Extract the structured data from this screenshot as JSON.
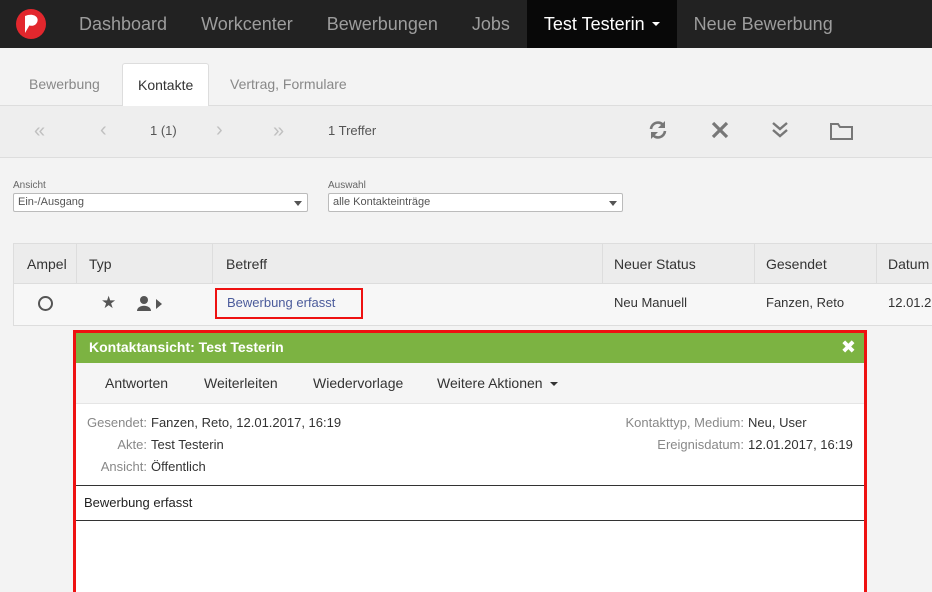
{
  "nav": {
    "logo_icon": "brand-logo-icon",
    "items": [
      {
        "label": "Dashboard"
      },
      {
        "label": "Workcenter"
      },
      {
        "label": "Bewerbungen"
      },
      {
        "label": "Jobs"
      },
      {
        "label": "Test Testerin"
      },
      {
        "label": "Neue Bewerbung"
      }
    ],
    "bg_color": "#222222"
  },
  "tabs": [
    {
      "label": "Bewerbung"
    },
    {
      "label": "Kontakte"
    },
    {
      "label": "Vertrag, Formulare"
    }
  ],
  "pager": {
    "first_icon": "«",
    "prev_icon": "‹",
    "page": "1 (1)",
    "next_icon": "›",
    "last_icon": "»",
    "hits": "1 Treffer"
  },
  "toolbar_icons": [
    "refresh-icon",
    "close-icon",
    "chevron-double-down-icon",
    "folder-icon"
  ],
  "filters": {
    "ansicht_label": "Ansicht",
    "ansicht_value": "Ein-/Ausgang",
    "auswahl_label": "Auswahl",
    "auswahl_value": "alle Kontakteinträge"
  },
  "table": {
    "columns": [
      "Ampel",
      "Typ",
      "Betreff",
      "Neuer Status",
      "Gesendet",
      "Datum"
    ],
    "rows": [
      {
        "betreff": "Bewerbung erfasst",
        "status": "Neu Manuell",
        "gesendet": "Fanzen, Reto",
        "datum": "12.01.2"
      }
    ]
  },
  "popup": {
    "title": "Kontaktansicht: Test Testerin",
    "header_color": "#7cb342",
    "actions": [
      "Antworten",
      "Weiterleiten",
      "Wiedervorlage",
      "Weitere Aktionen"
    ],
    "meta": {
      "gesendet_label": "Gesendet:",
      "gesendet_value": "Fanzen, Reto, 12.01.2017, 16:19",
      "akte_label": "Akte:",
      "akte_value": "Test Testerin",
      "ansicht_label": "Ansicht:",
      "ansicht_value": "Öffentlich",
      "kontakttyp_label": "Kontakttyp, Medium:",
      "kontakttyp_value": "Neu, User",
      "ereignis_label": "Ereignisdatum:",
      "ereignis_value": "12.01.2017, 16:19"
    },
    "subject": "Bewerbung erfasst"
  }
}
